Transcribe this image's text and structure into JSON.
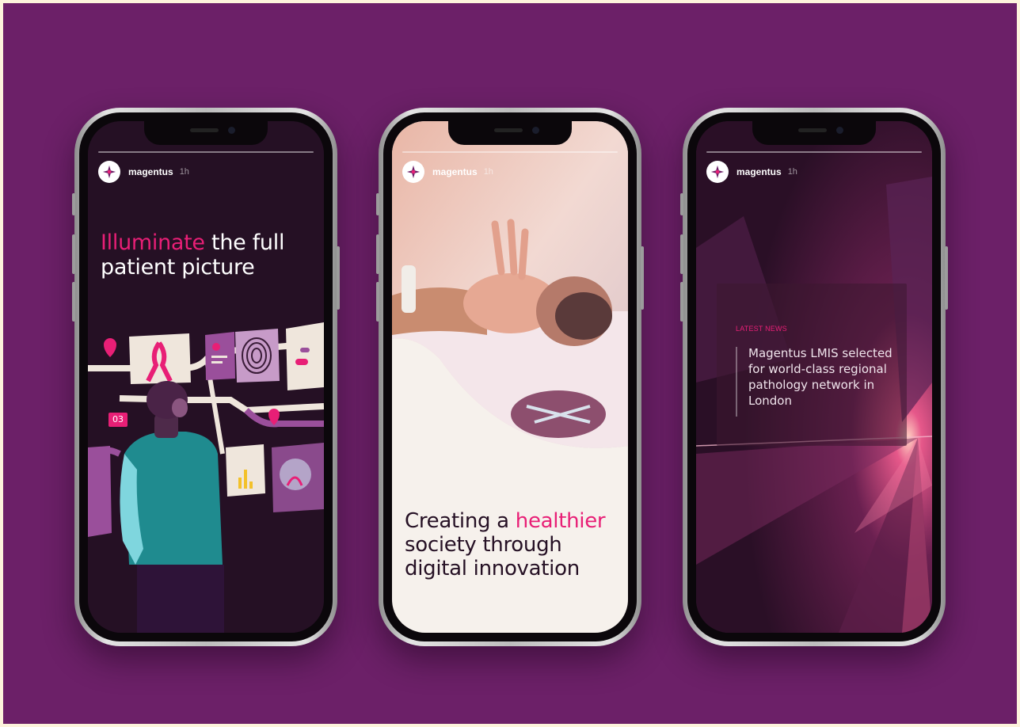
{
  "stories": [
    {
      "username": "magentus",
      "time": "1h",
      "headline_highlight": "Illuminate",
      "headline_rest_1": " the full",
      "headline_line2": "patient picture",
      "badge_number": "03"
    },
    {
      "username": "magentus",
      "time": "1h",
      "headline_line1_prefix": "Creating a ",
      "headline_highlight": "healthier",
      "headline_line2": "society through",
      "headline_line3": "digital innovation"
    },
    {
      "username": "magentus",
      "time": "1h",
      "news_label": "LATEST NEWS",
      "news_text": "Magentus LMIS selected for world-class regional pathology network in London"
    }
  ],
  "colors": {
    "background": "#6c2068",
    "accent_pink": "#e81f76",
    "dark_screen": "#251024",
    "cream": "#f6f1ec"
  }
}
